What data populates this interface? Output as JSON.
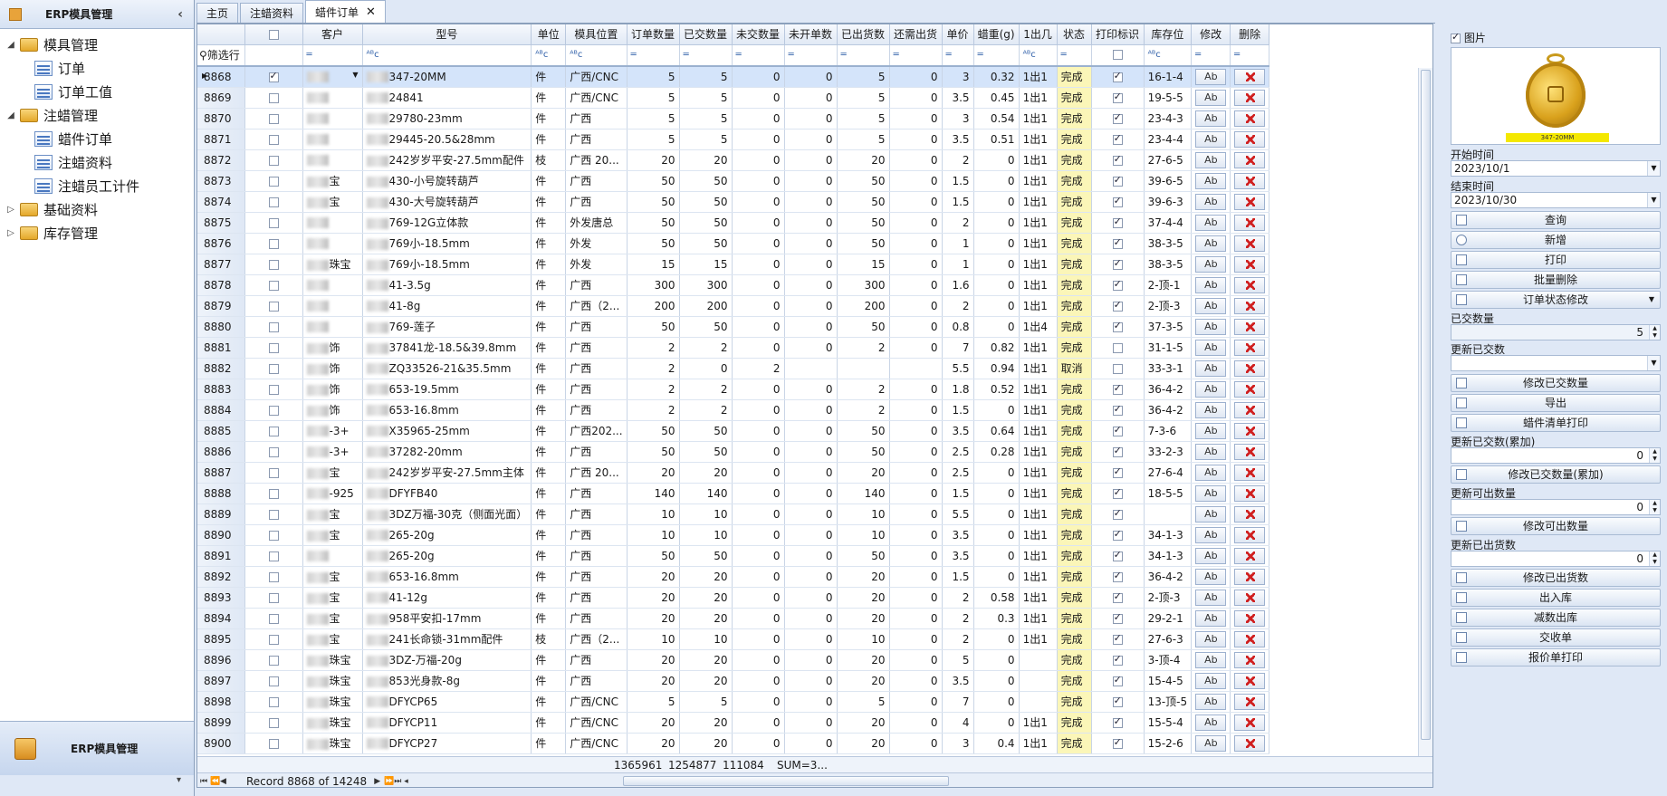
{
  "nav": {
    "title": "ERP模具管理",
    "groups": [
      {
        "label": "模具管理",
        "children": [
          "订单",
          "订单工值"
        ]
      },
      {
        "label": "注蜡管理",
        "children": [
          "蜡件订单",
          "注蜡资料",
          "注蜡员工计件"
        ]
      },
      {
        "label": "基础资料",
        "children": []
      },
      {
        "label": "库存管理",
        "children": []
      }
    ],
    "bottom_label": "ERP模具管理"
  },
  "tabs": [
    {
      "label": "主页",
      "active": false
    },
    {
      "label": "注蜡资料",
      "active": false
    },
    {
      "label": "蜡件订单",
      "active": true
    }
  ],
  "grid": {
    "columns": [
      "",
      "",
      "客户",
      "型号",
      "单位",
      "模具位置",
      "订单数量",
      "已交数量",
      "未交数量",
      "未开单数",
      "已出货数",
      "还需出货",
      "单价",
      "蜡重(g)",
      "1出几",
      "状态",
      "打印标识",
      "库存位",
      "修改",
      "删除"
    ],
    "filter_label": "筛选行",
    "rows": [
      {
        "id": "8868",
        "checked": true,
        "customer": "",
        "model": "347-20MM",
        "unit": "件",
        "location": "广西/CNC",
        "order_qty": "5",
        "delivered": "5",
        "undelivered": "0",
        "unbilled": "0",
        "shipped": "5",
        "remaining": "0",
        "price": "3",
        "wax": "0.32",
        "ratio": "1出1",
        "status": "完成",
        "printed": true,
        "stock": "16-1-4"
      },
      {
        "id": "8869",
        "checked": false,
        "customer": "",
        "model": "24841",
        "unit": "件",
        "location": "广西/CNC",
        "order_qty": "5",
        "delivered": "5",
        "undelivered": "0",
        "unbilled": "0",
        "shipped": "5",
        "remaining": "0",
        "price": "3.5",
        "wax": "0.45",
        "ratio": "1出1",
        "status": "完成",
        "printed": true,
        "stock": "19-5-5"
      },
      {
        "id": "8870",
        "checked": false,
        "customer": "",
        "model": "29780-23mm",
        "unit": "件",
        "location": "广西",
        "order_qty": "5",
        "delivered": "5",
        "undelivered": "0",
        "unbilled": "0",
        "shipped": "5",
        "remaining": "0",
        "price": "3",
        "wax": "0.54",
        "ratio": "1出1",
        "status": "完成",
        "printed": true,
        "stock": "23-4-3"
      },
      {
        "id": "8871",
        "checked": false,
        "customer": "",
        "model": "29445-20.5&28mm",
        "unit": "件",
        "location": "广西",
        "order_qty": "5",
        "delivered": "5",
        "undelivered": "0",
        "unbilled": "0",
        "shipped": "5",
        "remaining": "0",
        "price": "3.5",
        "wax": "0.51",
        "ratio": "1出1",
        "status": "完成",
        "printed": true,
        "stock": "23-4-4"
      },
      {
        "id": "8872",
        "checked": false,
        "customer": "",
        "model": "242岁岁平安-27.5mm配件",
        "unit": "枝",
        "location": "广西 20...",
        "order_qty": "20",
        "delivered": "20",
        "undelivered": "0",
        "unbilled": "0",
        "shipped": "20",
        "remaining": "0",
        "price": "2",
        "wax": "0",
        "ratio": "1出1",
        "status": "完成",
        "printed": true,
        "stock": "27-6-5"
      },
      {
        "id": "8873",
        "checked": false,
        "customer": "宝",
        "model": "430-小号旋转葫芦",
        "unit": "件",
        "location": "广西",
        "order_qty": "50",
        "delivered": "50",
        "undelivered": "0",
        "unbilled": "0",
        "shipped": "50",
        "remaining": "0",
        "price": "1.5",
        "wax": "0",
        "ratio": "1出1",
        "status": "完成",
        "printed": true,
        "stock": "39-6-5"
      },
      {
        "id": "8874",
        "checked": false,
        "customer": "宝",
        "model": "430-大号旋转葫芦",
        "unit": "件",
        "location": "广西",
        "order_qty": "50",
        "delivered": "50",
        "undelivered": "0",
        "unbilled": "0",
        "shipped": "50",
        "remaining": "0",
        "price": "1.5",
        "wax": "0",
        "ratio": "1出1",
        "status": "完成",
        "printed": true,
        "stock": "39-6-3"
      },
      {
        "id": "8875",
        "checked": false,
        "customer": "",
        "model": "769-12G立体款",
        "unit": "件",
        "location": "外发唐总",
        "order_qty": "50",
        "delivered": "50",
        "undelivered": "0",
        "unbilled": "0",
        "shipped": "50",
        "remaining": "0",
        "price": "2",
        "wax": "0",
        "ratio": "1出1",
        "status": "完成",
        "printed": true,
        "stock": "37-4-4"
      },
      {
        "id": "8876",
        "checked": false,
        "customer": "",
        "model": "769小-18.5mm",
        "unit": "件",
        "location": "外发",
        "order_qty": "50",
        "delivered": "50",
        "undelivered": "0",
        "unbilled": "0",
        "shipped": "50",
        "remaining": "0",
        "price": "1",
        "wax": "0",
        "ratio": "1出1",
        "status": "完成",
        "printed": true,
        "stock": "38-3-5"
      },
      {
        "id": "8877",
        "checked": false,
        "customer": "珠宝",
        "model": "769小-18.5mm",
        "unit": "件",
        "location": "外发",
        "order_qty": "15",
        "delivered": "15",
        "undelivered": "0",
        "unbilled": "0",
        "shipped": "15",
        "remaining": "0",
        "price": "1",
        "wax": "0",
        "ratio": "1出1",
        "status": "完成",
        "printed": true,
        "stock": "38-3-5"
      },
      {
        "id": "8878",
        "checked": false,
        "customer": "",
        "model": "41-3.5g",
        "unit": "件",
        "location": "广西",
        "order_qty": "300",
        "delivered": "300",
        "undelivered": "0",
        "unbilled": "0",
        "shipped": "300",
        "remaining": "0",
        "price": "1.6",
        "wax": "0",
        "ratio": "1出1",
        "status": "完成",
        "printed": true,
        "stock": "2-顶-1"
      },
      {
        "id": "8879",
        "checked": false,
        "customer": "",
        "model": "41-8g",
        "unit": "件",
        "location": "广西（2...",
        "order_qty": "200",
        "delivered": "200",
        "undelivered": "0",
        "unbilled": "0",
        "shipped": "200",
        "remaining": "0",
        "price": "2",
        "wax": "0",
        "ratio": "1出1",
        "status": "完成",
        "printed": true,
        "stock": "2-顶-3"
      },
      {
        "id": "8880",
        "checked": false,
        "customer": "",
        "model": "769-莲子",
        "unit": "件",
        "location": "广西",
        "order_qty": "50",
        "delivered": "50",
        "undelivered": "0",
        "unbilled": "0",
        "shipped": "50",
        "remaining": "0",
        "price": "0.8",
        "wax": "0",
        "ratio": "1出4",
        "status": "完成",
        "printed": true,
        "stock": "37-3-5"
      },
      {
        "id": "8881",
        "checked": false,
        "customer": "饰",
        "model": "37841龙-18.5&39.8mm",
        "unit": "件",
        "location": "广西",
        "order_qty": "2",
        "delivered": "2",
        "undelivered": "0",
        "unbilled": "0",
        "shipped": "2",
        "remaining": "0",
        "price": "7",
        "wax": "0.82",
        "ratio": "1出1",
        "status": "完成",
        "printed": false,
        "stock": "31-1-5"
      },
      {
        "id": "8882",
        "checked": false,
        "customer": "饰",
        "model": "ZQ33526-21&35.5mm",
        "unit": "件",
        "location": "广西",
        "order_qty": "2",
        "delivered": "0",
        "undelivered": "2",
        "unbilled": "",
        "shipped": "",
        "remaining": "",
        "price": "5.5",
        "wax": "0.94",
        "ratio": "1出1",
        "status": "取消",
        "printed": false,
        "stock": "33-3-1"
      },
      {
        "id": "8883",
        "checked": false,
        "customer": "饰",
        "model": "653-19.5mm",
        "unit": "件",
        "location": "广西",
        "order_qty": "2",
        "delivered": "2",
        "undelivered": "0",
        "unbilled": "0",
        "shipped": "2",
        "remaining": "0",
        "price": "1.8",
        "wax": "0.52",
        "ratio": "1出1",
        "status": "完成",
        "printed": true,
        "stock": "36-4-2"
      },
      {
        "id": "8884",
        "checked": false,
        "customer": "饰",
        "model": "653-16.8mm",
        "unit": "件",
        "location": "广西",
        "order_qty": "2",
        "delivered": "2",
        "undelivered": "0",
        "unbilled": "0",
        "shipped": "2",
        "remaining": "0",
        "price": "1.5",
        "wax": "0",
        "ratio": "1出1",
        "status": "完成",
        "printed": true,
        "stock": "36-4-2"
      },
      {
        "id": "8885",
        "checked": false,
        "customer": "-3+",
        "model": "X35965-25mm",
        "unit": "件",
        "location": "广西202...",
        "order_qty": "50",
        "delivered": "50",
        "undelivered": "0",
        "unbilled": "0",
        "shipped": "50",
        "remaining": "0",
        "price": "3.5",
        "wax": "0.64",
        "ratio": "1出1",
        "status": "完成",
        "printed": true,
        "stock": "7-3-6"
      },
      {
        "id": "8886",
        "checked": false,
        "customer": "-3+",
        "model": "37282-20mm",
        "unit": "件",
        "location": "广西",
        "order_qty": "50",
        "delivered": "50",
        "undelivered": "0",
        "unbilled": "0",
        "shipped": "50",
        "remaining": "0",
        "price": "2.5",
        "wax": "0.28",
        "ratio": "1出1",
        "status": "完成",
        "printed": true,
        "stock": "33-2-3"
      },
      {
        "id": "8887",
        "checked": false,
        "customer": "宝",
        "model": "242岁岁平安-27.5mm主体",
        "unit": "件",
        "location": "广西 20...",
        "order_qty": "20",
        "delivered": "20",
        "undelivered": "0",
        "unbilled": "0",
        "shipped": "20",
        "remaining": "0",
        "price": "2.5",
        "wax": "0",
        "ratio": "1出1",
        "status": "完成",
        "printed": true,
        "stock": "27-6-4"
      },
      {
        "id": "8888",
        "checked": false,
        "customer": "-925",
        "model": "DFYFB40",
        "unit": "件",
        "location": "广西",
        "order_qty": "140",
        "delivered": "140",
        "undelivered": "0",
        "unbilled": "0",
        "shipped": "140",
        "remaining": "0",
        "price": "1.5",
        "wax": "0",
        "ratio": "1出1",
        "status": "完成",
        "printed": true,
        "stock": "18-5-5"
      },
      {
        "id": "8889",
        "checked": false,
        "customer": "宝",
        "model": "3DZ万福-30克（侧面光面）",
        "unit": "件",
        "location": "广西",
        "order_qty": "10",
        "delivered": "10",
        "undelivered": "0",
        "unbilled": "0",
        "shipped": "10",
        "remaining": "0",
        "price": "5.5",
        "wax": "0",
        "ratio": "1出1",
        "status": "完成",
        "printed": true,
        "stock": ""
      },
      {
        "id": "8890",
        "checked": false,
        "customer": "宝",
        "model": "265-20g",
        "unit": "件",
        "location": "广西",
        "order_qty": "10",
        "delivered": "10",
        "undelivered": "0",
        "unbilled": "0",
        "shipped": "10",
        "remaining": "0",
        "price": "3.5",
        "wax": "0",
        "ratio": "1出1",
        "status": "完成",
        "printed": true,
        "stock": "34-1-3"
      },
      {
        "id": "8891",
        "checked": false,
        "customer": "",
        "model": "265-20g",
        "unit": "件",
        "location": "广西",
        "order_qty": "50",
        "delivered": "50",
        "undelivered": "0",
        "unbilled": "0",
        "shipped": "50",
        "remaining": "0",
        "price": "3.5",
        "wax": "0",
        "ratio": "1出1",
        "status": "完成",
        "printed": true,
        "stock": "34-1-3"
      },
      {
        "id": "8892",
        "checked": false,
        "customer": "宝",
        "model": "653-16.8mm",
        "unit": "件",
        "location": "广西",
        "order_qty": "20",
        "delivered": "20",
        "undelivered": "0",
        "unbilled": "0",
        "shipped": "20",
        "remaining": "0",
        "price": "1.5",
        "wax": "0",
        "ratio": "1出1",
        "status": "完成",
        "printed": true,
        "stock": "36-4-2"
      },
      {
        "id": "8893",
        "checked": false,
        "customer": "宝",
        "model": "41-12g",
        "unit": "件",
        "location": "广西",
        "order_qty": "20",
        "delivered": "20",
        "undelivered": "0",
        "unbilled": "0",
        "shipped": "20",
        "remaining": "0",
        "price": "2",
        "wax": "0.58",
        "ratio": "1出1",
        "status": "完成",
        "printed": true,
        "stock": "2-顶-3"
      },
      {
        "id": "8894",
        "checked": false,
        "customer": "宝",
        "model": "958平安扣-17mm",
        "unit": "件",
        "location": "广西",
        "order_qty": "20",
        "delivered": "20",
        "undelivered": "0",
        "unbilled": "0",
        "shipped": "20",
        "remaining": "0",
        "price": "2",
        "wax": "0.3",
        "ratio": "1出1",
        "status": "完成",
        "printed": true,
        "stock": "29-2-1"
      },
      {
        "id": "8895",
        "checked": false,
        "customer": "宝",
        "model": "241长命锁-31mm配件",
        "unit": "枝",
        "location": "广西（2...",
        "order_qty": "10",
        "delivered": "10",
        "undelivered": "0",
        "unbilled": "0",
        "shipped": "10",
        "remaining": "0",
        "price": "2",
        "wax": "0",
        "ratio": "1出1",
        "status": "完成",
        "printed": true,
        "stock": "27-6-3"
      },
      {
        "id": "8896",
        "checked": false,
        "customer": "珠宝",
        "model": "3DZ-万福-20g",
        "unit": "件",
        "location": "广西",
        "order_qty": "20",
        "delivered": "20",
        "undelivered": "0",
        "unbilled": "0",
        "shipped": "20",
        "remaining": "0",
        "price": "5",
        "wax": "0",
        "ratio": "",
        "status": "完成",
        "printed": true,
        "stock": "3-顶-4"
      },
      {
        "id": "8897",
        "checked": false,
        "customer": "珠宝",
        "model": "853光身款-8g",
        "unit": "件",
        "location": "广西",
        "order_qty": "20",
        "delivered": "20",
        "undelivered": "0",
        "unbilled": "0",
        "shipped": "20",
        "remaining": "0",
        "price": "3.5",
        "wax": "0",
        "ratio": "",
        "status": "完成",
        "printed": true,
        "stock": "15-4-5"
      },
      {
        "id": "8898",
        "checked": false,
        "customer": "珠宝",
        "model": "DFYCP65",
        "unit": "件",
        "location": "广西/CNC",
        "order_qty": "5",
        "delivered": "5",
        "undelivered": "0",
        "unbilled": "0",
        "shipped": "5",
        "remaining": "0",
        "price": "7",
        "wax": "0",
        "ratio": "",
        "status": "完成",
        "printed": true,
        "stock": "13-顶-5"
      },
      {
        "id": "8899",
        "checked": false,
        "customer": "珠宝",
        "model": "DFYCP11",
        "unit": "件",
        "location": "广西/CNC",
        "order_qty": "20",
        "delivered": "20",
        "undelivered": "0",
        "unbilled": "0",
        "shipped": "20",
        "remaining": "0",
        "price": "4",
        "wax": "0",
        "ratio": "1出1",
        "status": "完成",
        "printed": true,
        "stock": "15-5-4"
      },
      {
        "id": "8900",
        "checked": false,
        "customer": "珠宝",
        "model": "DFYCP27",
        "unit": "件",
        "location": "广西/CNC",
        "order_qty": "20",
        "delivered": "20",
        "undelivered": "0",
        "unbilled": "0",
        "shipped": "20",
        "remaining": "0",
        "price": "3",
        "wax": "0.4",
        "ratio": "1出1",
        "status": "完成",
        "printed": true,
        "stock": "15-2-6"
      }
    ],
    "totals": {
      "order_qty": "1365961",
      "delivered": "1254877",
      "undelivered": "111084",
      "shipped": "SUM=3..."
    },
    "record_text": "Record 8868 of 14248"
  },
  "right": {
    "image_label": "图片",
    "image_caption": "347-20MM",
    "start_label": "开始时间",
    "start_value": "2023/10/1",
    "end_label": "结束时间",
    "end_value": "2023/10/30",
    "buttons": {
      "query": "查询",
      "add": "新增",
      "print": "打印",
      "batch_delete": "批量删除",
      "status_change": "订单状态修改",
      "modify_delivered": "修改已交数量",
      "export": "导出",
      "wax_list_print": "蜡件清单打印",
      "modify_delivered_acc": "修改已交数量(累加)",
      "modify_shippable": "修改可出数量",
      "modify_shipped": "修改已出货数",
      "stock_io": "出入库",
      "stock_reduce": "减数出库",
      "delivery_note": "交收单",
      "quote_print": "报价单打印"
    },
    "delivered_label": "已交数量",
    "delivered_value": "5",
    "update_delivered_label": "更新已交数",
    "update_delivered_value": "",
    "update_delivered_acc_label": "更新已交数(累加)",
    "update_delivered_acc_value": "0",
    "update_shippable_label": "更新可出数量",
    "update_shippable_value": "0",
    "update_shipped_label": "更新已出货数",
    "update_shipped_value": "0"
  }
}
